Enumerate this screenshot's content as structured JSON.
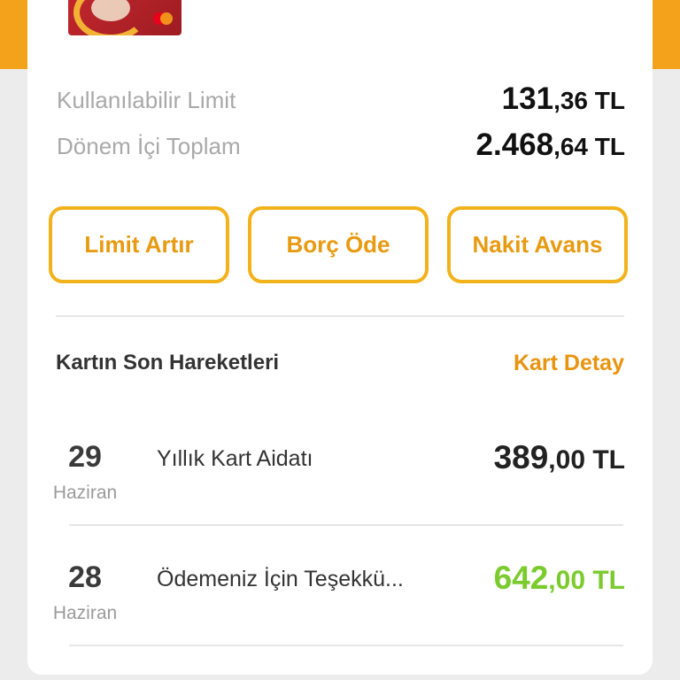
{
  "card": {
    "image": "galatasaray-mastercard-icon"
  },
  "limits": [
    {
      "label": "Kullanılabilir Limit",
      "amount_int": "131",
      "amount_dec": ",36 TL"
    },
    {
      "label": "Dönem İçi Toplam",
      "amount_int": "2.468",
      "amount_dec": ",64 TL"
    }
  ],
  "actions": [
    {
      "label": "Limit Artır"
    },
    {
      "label": "Borç Öde"
    },
    {
      "label": "Nakit Avans"
    }
  ],
  "recent": {
    "title": "Kartın Son Hareketleri",
    "detail_link": "Kart Detay"
  },
  "transactions": [
    {
      "day": "29",
      "month": "Haziran",
      "description": "Yıllık Kart Aidatı",
      "amount_int": "389",
      "amount_dec": ",00 TL",
      "color": "#222222"
    },
    {
      "day": "28",
      "month": "Haziran",
      "description": "Ödemeniz İçin Teşekkü...",
      "amount_int": "642",
      "amount_dec": ",00 TL",
      "color": "#7ccb2e"
    }
  ],
  "colors": {
    "accent": "#f4a21c",
    "button_border": "#f2b21b",
    "button_text": "#e89a10",
    "positive": "#7ccb2e"
  }
}
